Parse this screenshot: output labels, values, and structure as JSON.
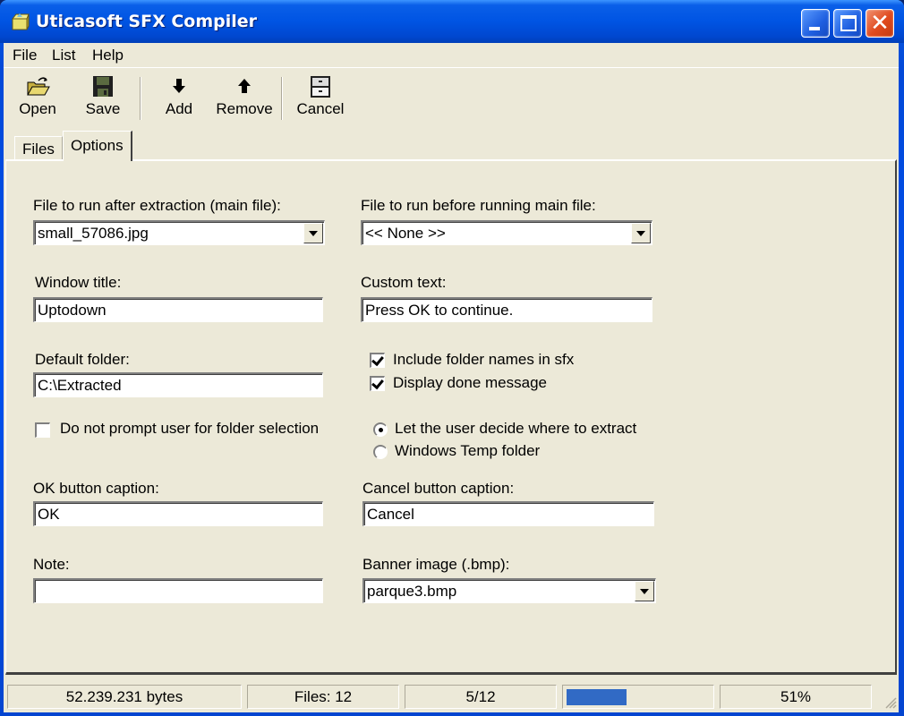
{
  "window": {
    "title": "Uticasoft SFX Compiler"
  },
  "menu": [
    {
      "label": "File"
    },
    {
      "label": "List"
    },
    {
      "label": "Help"
    }
  ],
  "toolbar": {
    "open_label": "Open",
    "save_label": "Save",
    "add_label": "Add",
    "remove_label": "Remove",
    "cancel_label": "Cancel"
  },
  "tabs": [
    {
      "label": "Files",
      "active": false
    },
    {
      "label": "Options",
      "active": true
    }
  ],
  "options": {
    "main_file": {
      "label": "File to run after extraction (main file):",
      "value": "small_57086.jpg"
    },
    "pre_file": {
      "label": "File to run before running main file:",
      "value": "<< None >>"
    },
    "window_title": {
      "label": "Window title:",
      "value": "Uptodown"
    },
    "custom_text": {
      "label": "Custom text:",
      "value": "Press OK to continue."
    },
    "default_folder": {
      "label": "Default folder:",
      "value": "C:\\Extracted"
    },
    "include_folder_names": {
      "label": "Include folder names in sfx",
      "checked": true
    },
    "display_done_message": {
      "label": "Display done message",
      "checked": true
    },
    "no_prompt_folder": {
      "label": "Do not prompt user for folder selection",
      "checked": false
    },
    "extract_location": {
      "options": [
        {
          "label": "Let the user decide where to extract",
          "selected": true
        },
        {
          "label": "Windows Temp folder",
          "selected": false
        }
      ]
    },
    "ok_caption": {
      "label": "OK button caption:",
      "value": "OK"
    },
    "cancel_caption": {
      "label": "Cancel button caption:",
      "value": "Cancel"
    },
    "note": {
      "label": "Note:",
      "value": ""
    },
    "banner_image": {
      "label": "Banner image (.bmp):",
      "value": "parque3.bmp"
    }
  },
  "statusbar": {
    "bytes": "52.239.231 bytes",
    "files": "Files: 12",
    "progress_count": "5/12",
    "progress_fraction": 0.42,
    "percent": "51%",
    "accent_color": "#316ac5"
  }
}
